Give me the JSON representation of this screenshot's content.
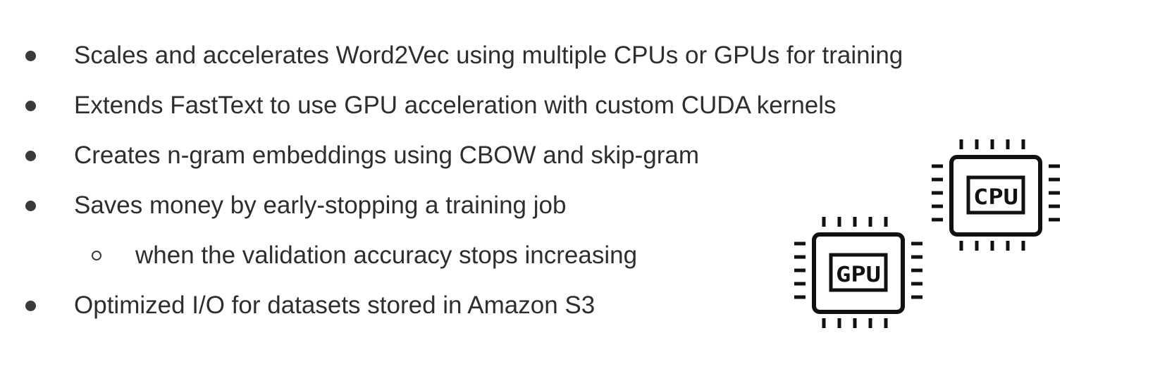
{
  "bullets": [
    {
      "text": "Scales and accelerates Word2Vec using multiple CPUs or GPUs for training",
      "level": 1
    },
    {
      "text": "Extends FastText to use GPU acceleration with custom CUDA kernels",
      "level": 1
    },
    {
      "text": "Creates n-gram embeddings using CBOW and skip-gram",
      "level": 1
    },
    {
      "text": "Saves money by early-stopping a training job",
      "level": 1
    },
    {
      "text": "when the validation accuracy stops increasing",
      "level": 2
    },
    {
      "text": "Optimized I/O for datasets stored in Amazon S3",
      "level": 1
    }
  ],
  "icons": {
    "cpu": {
      "name": "cpu-chip-icon",
      "label": "CPU"
    },
    "gpu": {
      "name": "gpu-chip-icon",
      "label": "GPU"
    }
  },
  "colors": {
    "text": "#2e2e2e",
    "icon_stroke": "#111111",
    "background": "#ffffff"
  }
}
